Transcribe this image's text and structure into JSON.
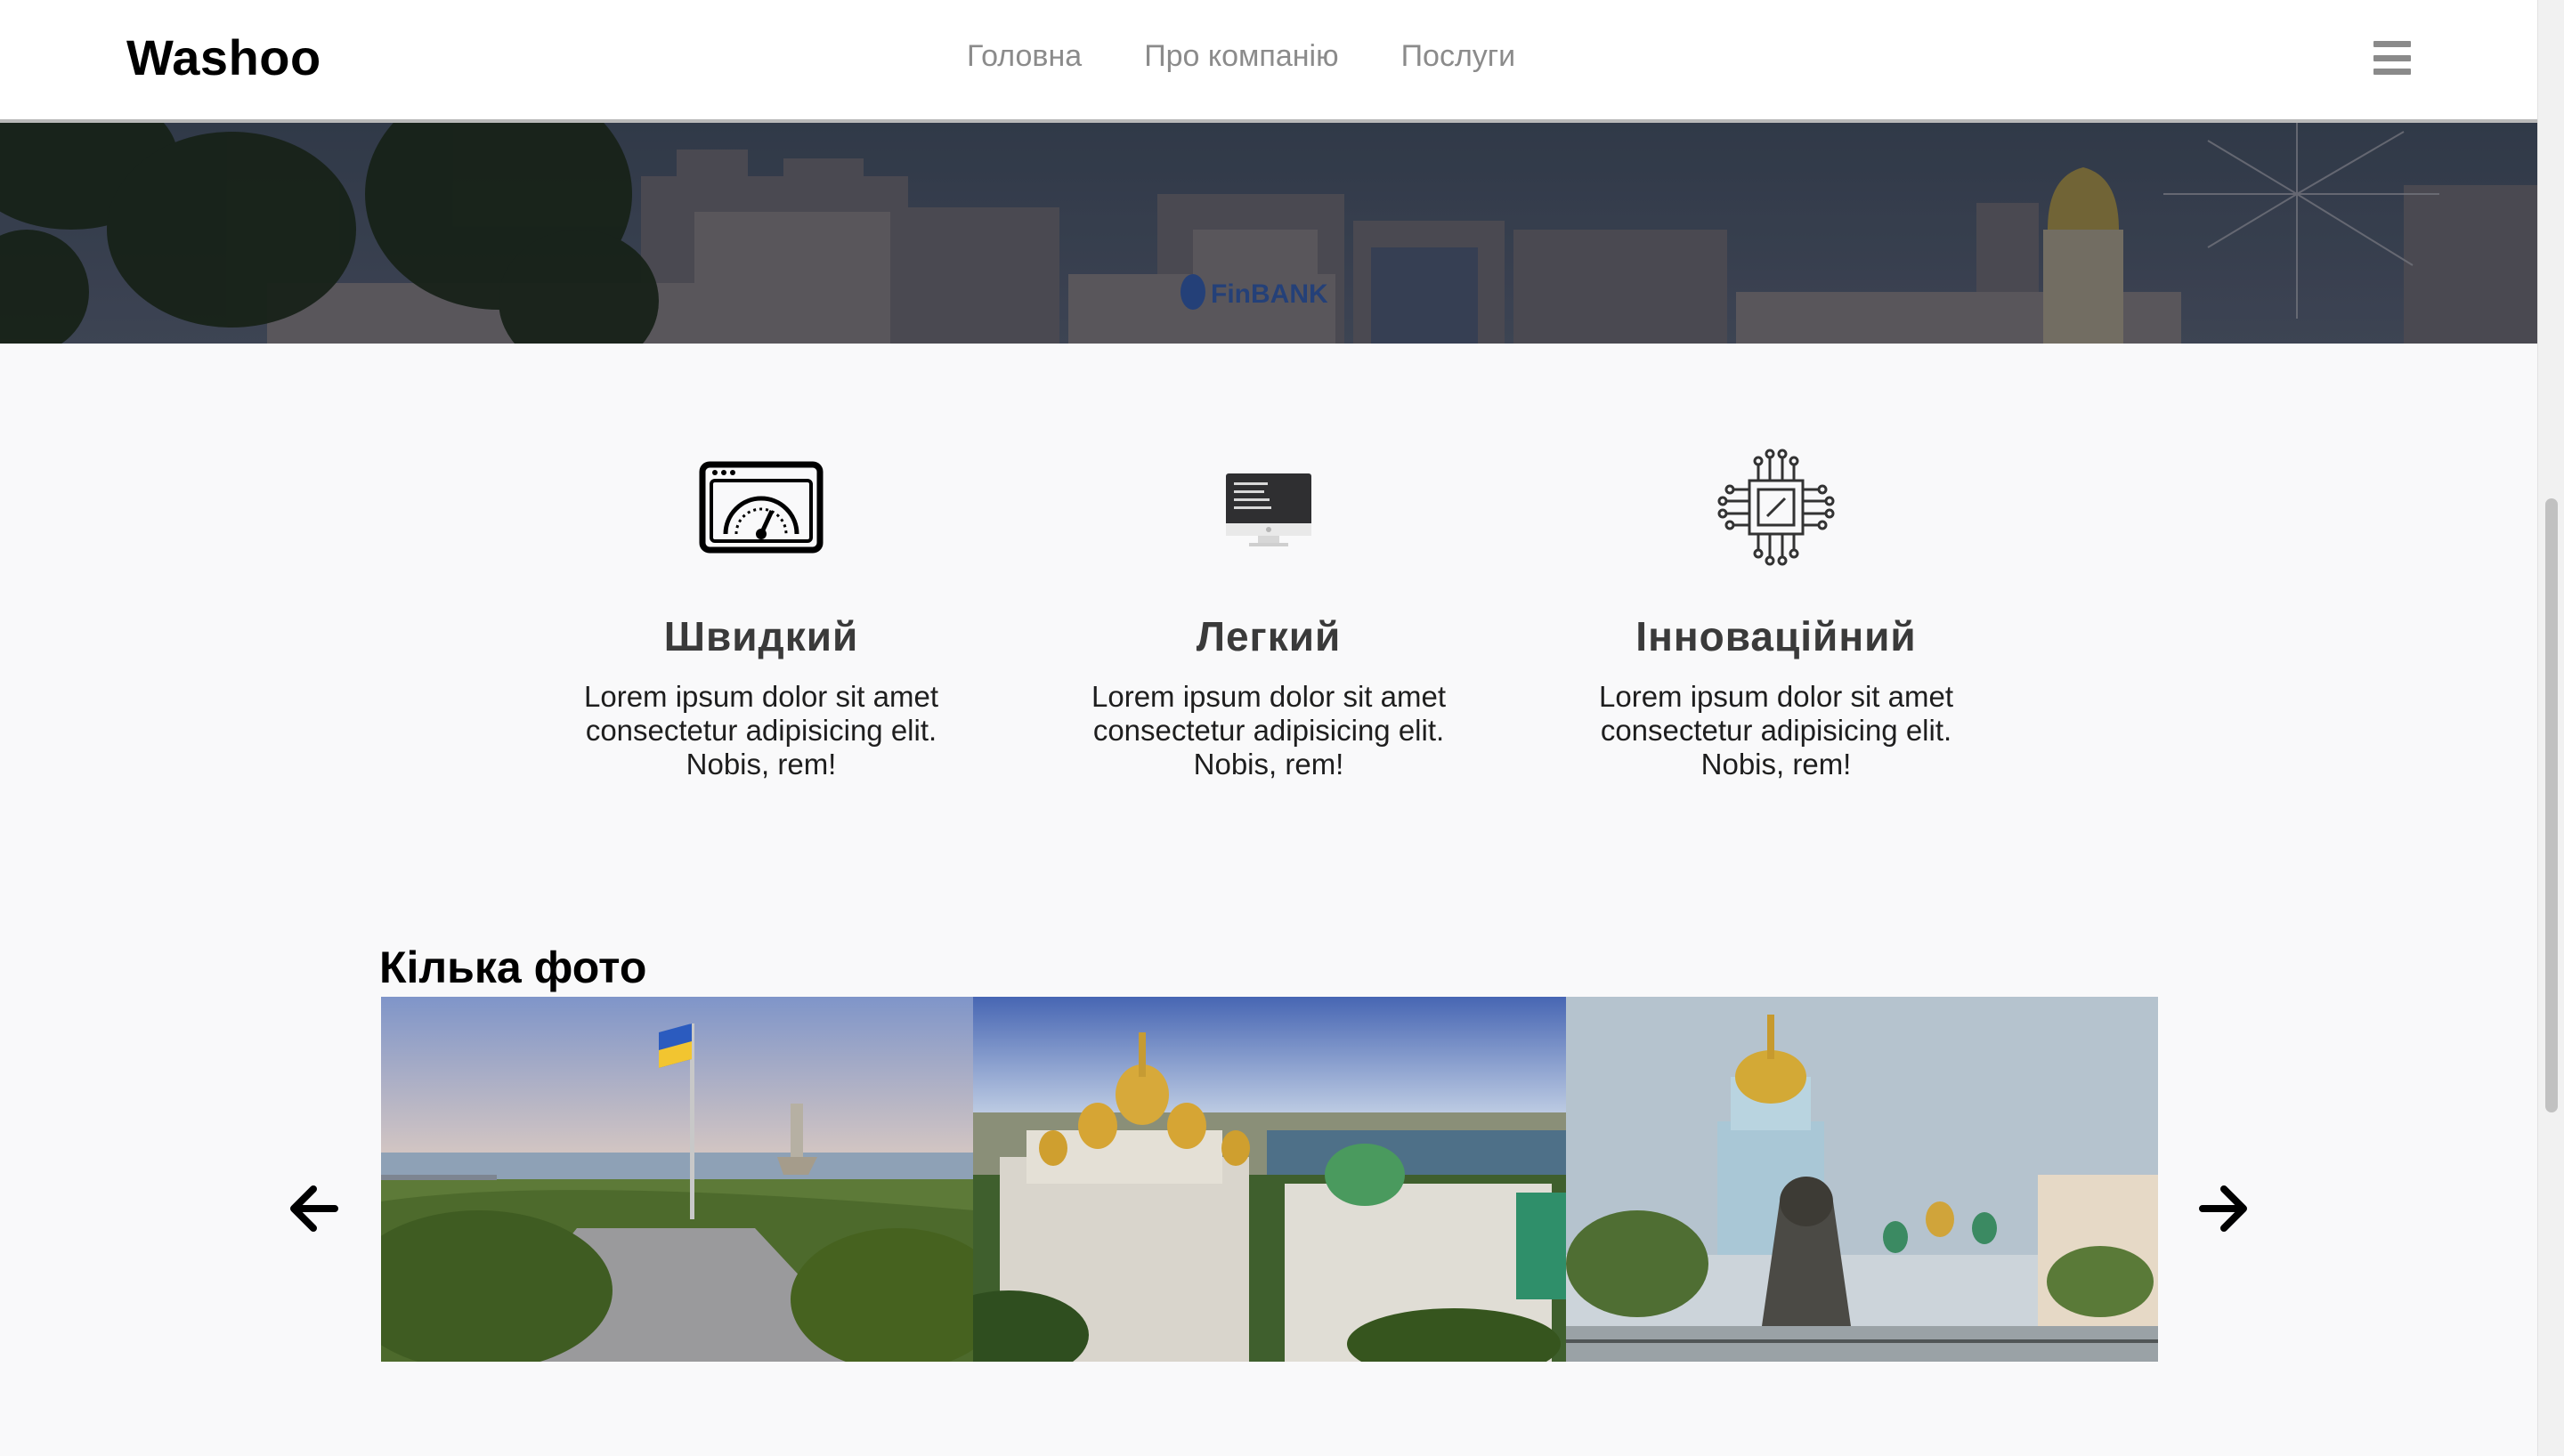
{
  "header": {
    "brand": "Washoo",
    "nav": [
      {
        "label": "Головна"
      },
      {
        "label": "Про компанію"
      },
      {
        "label": "Послуги"
      }
    ],
    "menu_icon": "hamburger-icon"
  },
  "features": [
    {
      "icon": "speedometer-icon",
      "title": "Швидкий",
      "text": "Lorem ipsum dolor sit amet consectetur adipisicing elit. Nobis, rem!"
    },
    {
      "icon": "code-monitor-icon",
      "title": "Легкий",
      "text": "Lorem ipsum dolor sit amet consectetur adipisicing elit. Nobis, rem!"
    },
    {
      "icon": "processor-chip-icon",
      "title": "Інноваційний",
      "text": "Lorem ipsum dolor sit amet consectetur adipisicing elit. Nobis, rem!"
    }
  ],
  "gallery": {
    "title": "Кілька фото",
    "prev_icon": "arrow-left-icon",
    "next_icon": "arrow-right-icon"
  },
  "hero": {
    "sign_text": "FinBANK"
  },
  "colors": {
    "nav_text": "#8b8b8b",
    "feature_title": "#3a3a3a",
    "page_bg": "#f9f9fa"
  }
}
